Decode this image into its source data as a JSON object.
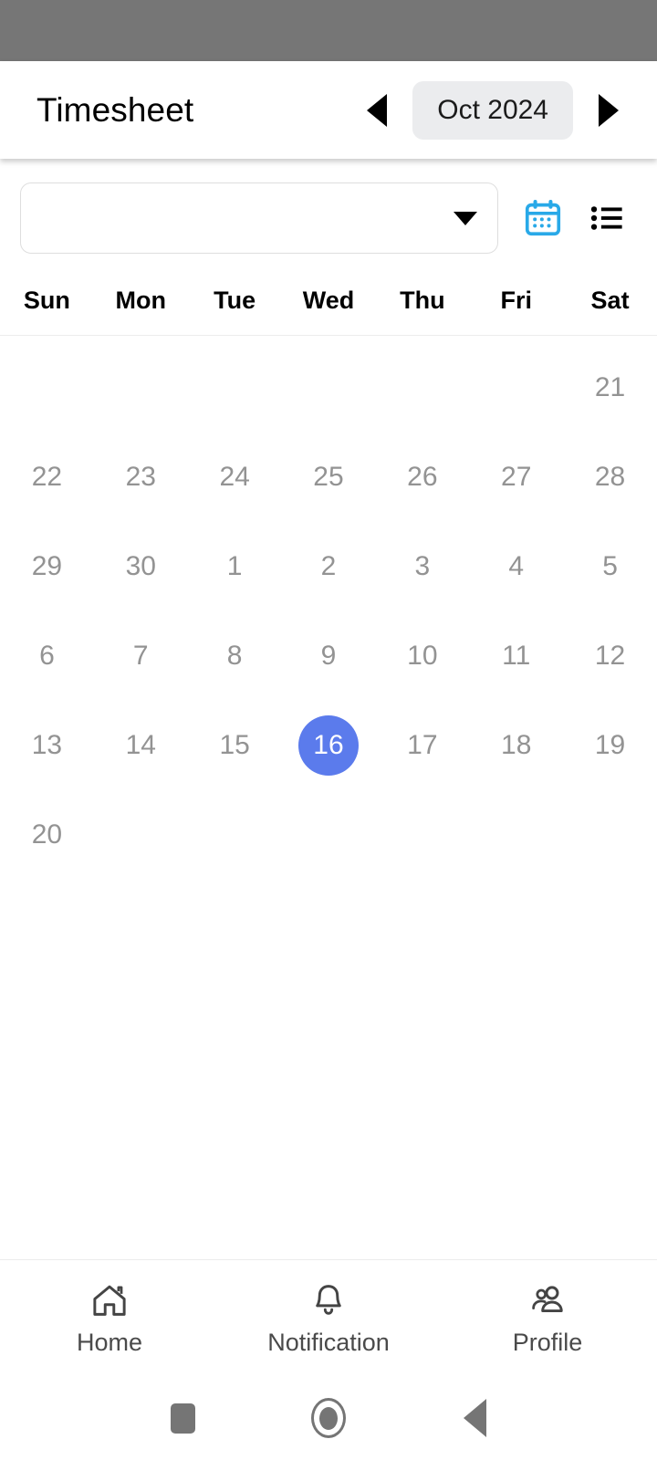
{
  "status_bar": {
    "color": "#767676"
  },
  "app_bar": {
    "title": "Timesheet",
    "prev_label": "Previous month",
    "next_label": "Next month",
    "month_label": "Oct 2024"
  },
  "filter_row": {
    "dropdown_value": "",
    "dropdown_placeholder": "",
    "calendar_icon": "calendar-icon",
    "list_icon": "list-view-icon",
    "calendar_icon_color": "#29A9E8",
    "list_icon_color": "#000000"
  },
  "calendar": {
    "weekdays": [
      "Sun",
      "Mon",
      "Tue",
      "Wed",
      "Thu",
      "Fri",
      "Sat"
    ],
    "selected_day": "16",
    "selected_color": "#5B7BEC",
    "day_color": "#939393",
    "rows": [
      [
        "",
        "",
        "",
        "",
        "",
        "",
        "21"
      ],
      [
        "22",
        "23",
        "24",
        "25",
        "26",
        "27",
        "28"
      ],
      [
        "29",
        "30",
        "1",
        "2",
        "3",
        "4",
        "5"
      ],
      [
        "6",
        "7",
        "8",
        "9",
        "10",
        "11",
        "12"
      ],
      [
        "13",
        "14",
        "15",
        "16",
        "17",
        "18",
        "19"
      ],
      [
        "20",
        "",
        "",
        "",
        "",
        "",
        ""
      ]
    ]
  },
  "bottom_nav": {
    "items": [
      {
        "label": "Home",
        "icon": "home-icon"
      },
      {
        "label": "Notification",
        "icon": "bell-icon"
      },
      {
        "label": "Profile",
        "icon": "people-icon"
      }
    ]
  },
  "system_nav": {
    "recents_label": "Recents",
    "home_label": "Home",
    "back_label": "Back",
    "color": "#757575"
  }
}
